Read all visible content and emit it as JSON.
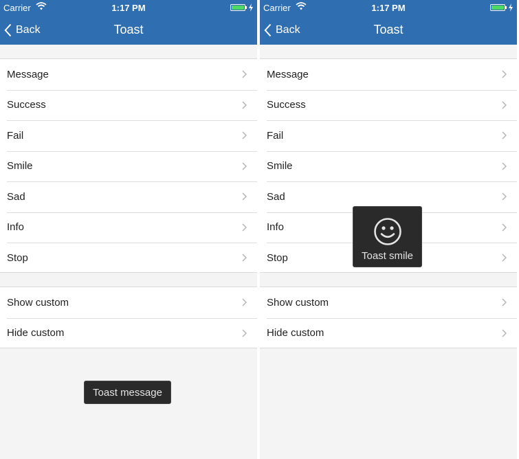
{
  "status_bar": {
    "carrier": "Carrier",
    "time": "1:17 PM",
    "battery_color": "#4cd964"
  },
  "nav": {
    "back_label": "Back",
    "title": "Toast",
    "bar_color": "#2f6eb0"
  },
  "menu": {
    "section1": [
      "Message",
      "Success",
      "Fail",
      "Smile",
      "Sad",
      "Info",
      "Stop"
    ],
    "section2": [
      "Show custom",
      "Hide custom"
    ]
  },
  "toasts": {
    "message_text": "Toast message",
    "smile_text": "Toast smile",
    "smile_icon": "smile-face-icon"
  }
}
